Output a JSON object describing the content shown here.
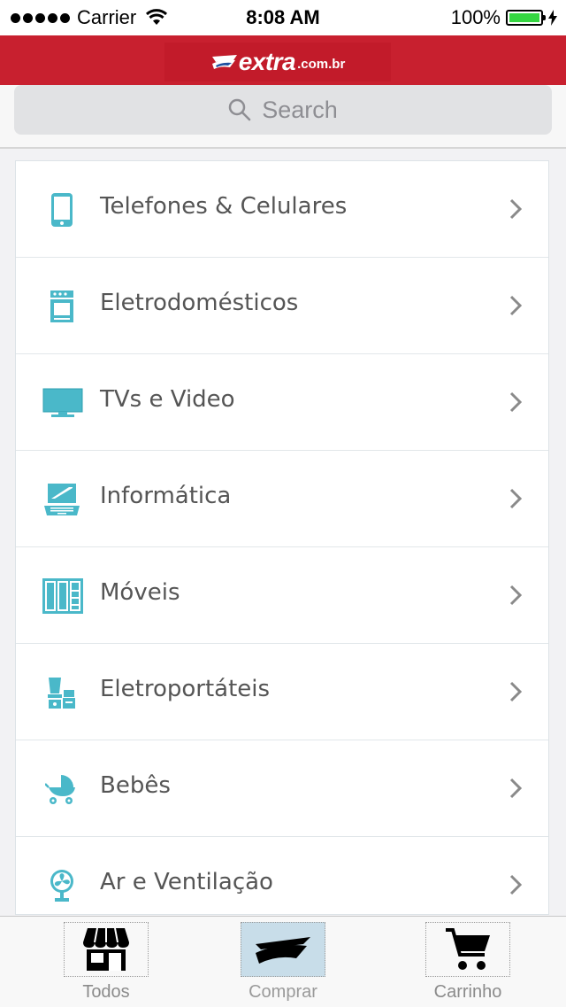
{
  "status_bar": {
    "carrier": "Carrier",
    "time": "8:08 AM",
    "battery": "100%",
    "battery_color": "#35d641"
  },
  "header": {
    "logo_main": "extra",
    "logo_domain": ".com.br",
    "brand_color": "#c8202f"
  },
  "search": {
    "placeholder": "Search"
  },
  "categories": [
    {
      "label": "Telefones & Celulares",
      "icon": "phone-icon"
    },
    {
      "label": "Eletrodomésticos",
      "icon": "stove-icon"
    },
    {
      "label": "TVs e Video",
      "icon": "tv-icon"
    },
    {
      "label": "Informática",
      "icon": "laptop-icon"
    },
    {
      "label": "Móveis",
      "icon": "wardrobe-icon"
    },
    {
      "label": "Eletroportáteis",
      "icon": "blender-icon"
    },
    {
      "label": "Bebês",
      "icon": "stroller-icon"
    },
    {
      "label": "Ar e Ventilação",
      "icon": "fan-icon"
    }
  ],
  "icon_color": "#4ab8c9",
  "tabs": [
    {
      "label": "Todos",
      "icon": "store-icon",
      "active": false
    },
    {
      "label": "Comprar",
      "icon": "extra-logo-icon",
      "active": true
    },
    {
      "label": "Carrinho",
      "icon": "cart-icon",
      "active": false
    }
  ]
}
